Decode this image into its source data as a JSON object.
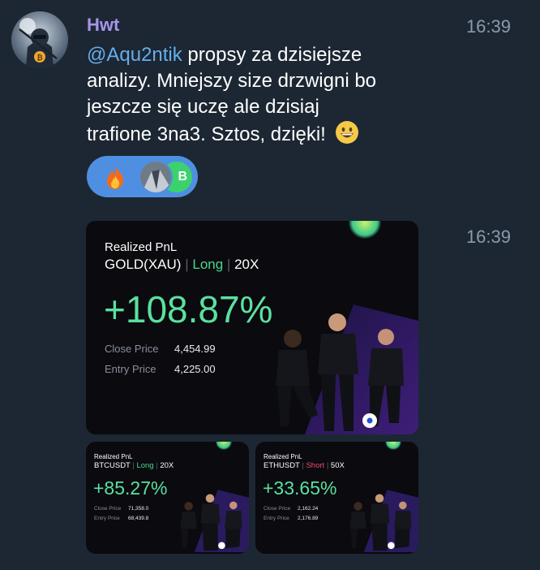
{
  "message1": {
    "sender": "Hwt",
    "time": "16:39",
    "mention": "@Aqu2ntik",
    "text_line1_rest": " propsy za dzisiejsze",
    "text_line2": "analizy. Mniejszy size drzwigni bo",
    "text_line3": "jeszcze się uczę ale dzisiaj",
    "text_line4": "trafione 3na3. Sztos, dzięki!",
    "emoji": "grinning-face",
    "reactions": [
      {
        "emoji": "fire",
        "users": [
          "user-photo-avatar",
          "green-letter-avatar"
        ]
      }
    ],
    "reaction_avatar_letter": "B"
  },
  "message2": {
    "time": "16:39"
  },
  "cards": {
    "main": {
      "title": "Realized PnL",
      "pair": "GOLD(XAU)",
      "side": "Long",
      "leverage": "20X",
      "pnl": "+108.87%",
      "close_label": "Close Price",
      "close_value": "4,454.99",
      "entry_label": "Entry Price",
      "entry_value": "4,225.00"
    },
    "small1": {
      "title": "Realized PnL",
      "pair": "BTCUSDT",
      "side": "Long",
      "leverage": "20X",
      "pnl": "+85.27%",
      "close_label": "Close Price",
      "close_value": "71,358.0",
      "entry_label": "Entry Price",
      "entry_value": "68,439.8"
    },
    "small2": {
      "title": "Realized PnL",
      "pair": "ETHUSDT",
      "side": "Short",
      "leverage": "50X",
      "pnl": "+33.65%",
      "close_label": "Close Price",
      "close_value": "2,162.24",
      "entry_label": "Entry Price",
      "entry_value": "2,176.89"
    }
  },
  "colors": {
    "background": "#1c2733",
    "sender_name": "#a694e8",
    "mention": "#65aeeb",
    "reaction_pill": "#4f8fe2",
    "profit_green": "#5be0a0",
    "long_green": "#49d88f",
    "short_red": "#f24e63"
  }
}
